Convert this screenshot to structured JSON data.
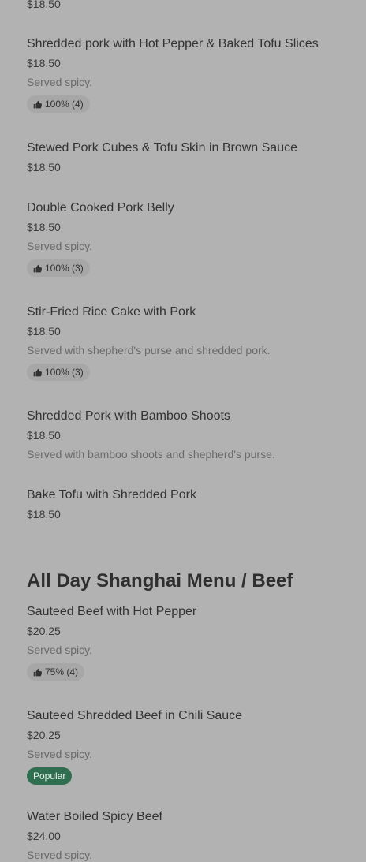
{
  "top_fragment": {
    "price": "$18.50"
  },
  "pork_items": [
    {
      "name": "Shredded pork with Hot Pepper & Baked Tofu Slices",
      "price": "$18.50",
      "desc": "Served spicy.",
      "rating": "100% (4)"
    },
    {
      "name": "Stewed Pork Cubes & Tofu Skin in Brown Sauce",
      "price": "$18.50"
    },
    {
      "name": "Double Cooked Pork Belly",
      "price": "$18.50",
      "desc": "Served spicy.",
      "rating": "100% (3)"
    },
    {
      "name": "Stir-Fried Rice Cake with Pork",
      "price": "$18.50",
      "desc": "Served with shepherd's purse and shredded pork.",
      "rating": "100% (3)"
    },
    {
      "name": "Shredded Pork with Bamboo Shoots",
      "price": "$18.50",
      "desc": "Served with bamboo shoots and shepherd's purse."
    },
    {
      "name": "Bake Tofu with Shredded Pork",
      "price": "$18.50"
    }
  ],
  "beef_section": {
    "title": "All Day Shanghai Menu / Beef",
    "items": [
      {
        "name": "Sauteed Beef with Hot Pepper",
        "price": "$20.25",
        "desc": "Served spicy.",
        "rating": "75% (4)"
      },
      {
        "name": "Sauteed Shredded Beef in Chili Sauce",
        "price": "$20.25",
        "desc": "Served spicy.",
        "badge": "Popular"
      },
      {
        "name": "Water Boiled Spicy Beef",
        "price": "$24.00",
        "desc": "Served spicy."
      }
    ]
  },
  "icons": {
    "rating_icon": "thumbs-up-icon"
  },
  "colors": {
    "background": "#b2b2b2",
    "popular_badge": "#2f6f4f"
  }
}
